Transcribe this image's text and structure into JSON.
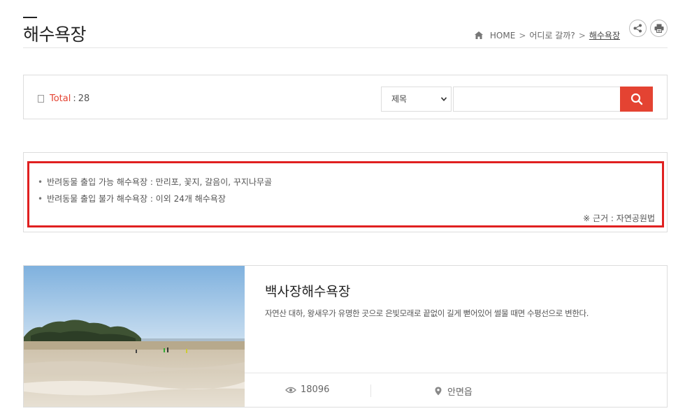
{
  "header": {
    "title": "해수욕장",
    "breadcrumb": {
      "home": "HOME",
      "sep": ">",
      "parent": "어디로 갈까?",
      "current": "해수욕장"
    }
  },
  "search": {
    "total_label": "Total",
    "total_sep": ":",
    "total_value": "28",
    "select_value": "제목",
    "input_value": "",
    "input_placeholder": ""
  },
  "notice": {
    "items": [
      "반려동물 출입 가능 해수욕장 : 만리포, 꽃지, 갈음이, 꾸지나무골",
      "반려동물 출입 불가 해수욕장 : 이외 24개 해수욕장"
    ],
    "reference": "※ 근거 : 자연공원법"
  },
  "card": {
    "title": "백사장해수욕장",
    "description": "자연산 대하, 왕새우가 유명한 곳으로 은빛모래로 끝없이 길게 뻗어있어 썰물 때면 수평선으로 변한다.",
    "views": "18096",
    "location": "안면읍"
  },
  "colors": {
    "accent": "#e44332",
    "notice_border": "#e02020"
  }
}
